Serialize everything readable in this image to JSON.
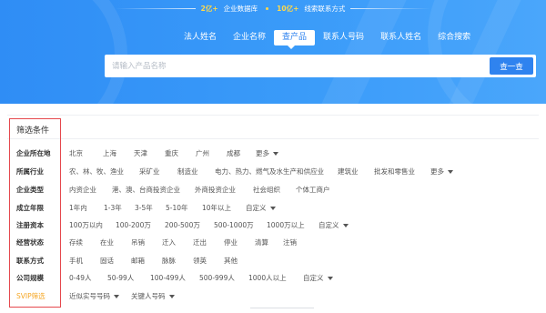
{
  "tagline": {
    "highlight_1": "2亿+",
    "text_1": "企业数据库",
    "highlight_2": "10亿+",
    "text_2": "线索联系方式"
  },
  "tabs": [
    {
      "label": "法人姓名",
      "active": false
    },
    {
      "label": "企业名称",
      "active": false
    },
    {
      "label": "查产品",
      "active": true
    },
    {
      "label": "联系人号码",
      "active": false
    },
    {
      "label": "联系人姓名",
      "active": false
    },
    {
      "label": "综合搜索",
      "active": false
    }
  ],
  "search": {
    "placeholder": "请输入产品名称",
    "value": "",
    "button_label": "查一查"
  },
  "filter": {
    "title": "筛选条件",
    "rows": [
      {
        "label": "企业所在地",
        "options": [
          "北京",
          "上海",
          "天津",
          "重庆",
          "广州",
          "成都",
          "更多"
        ]
      },
      {
        "label": "所属行业",
        "options": [
          "农、林、牧、渔业",
          "采矿业",
          "制造业",
          "电力、热力、燃气及水生产和供应业",
          "建筑业",
          "批发和零售业",
          "更多"
        ]
      },
      {
        "label": "企业类型",
        "options": [
          "内资企业",
          "港、澳、台商投资企业",
          "外商投资企业",
          "社会组织",
          "个体工商户"
        ]
      },
      {
        "label": "成立年限",
        "options": [
          "1年内",
          "1-3年",
          "3-5年",
          "5-10年",
          "10年以上",
          "自定义"
        ]
      },
      {
        "label": "注册资本",
        "options": [
          "100万以内",
          "100-200万",
          "200-500万",
          "500-1000万",
          "1000万以上",
          "自定义"
        ]
      },
      {
        "label": "经营状态",
        "options": [
          "存续",
          "在业",
          "吊销",
          "迁入",
          "迁出",
          "停业",
          "清算",
          "注销"
        ]
      },
      {
        "label": "联系方式",
        "options": [
          "手机",
          "固话",
          "邮箱",
          "脉脉",
          "领英",
          "其他"
        ]
      },
      {
        "label": "公司规模",
        "options": [
          "0-49人",
          "50-99人",
          "100-499人",
          "500-999人",
          "1000人以上",
          "自定义"
        ]
      },
      {
        "label": "SVIP筛选",
        "options": [
          "近似实号号码",
          "关键人号码"
        ]
      }
    ]
  },
  "colors": {
    "brand_blue": "#2f83ef",
    "accent_yellow": "#ffd84a",
    "svip_orange": "#f5a623",
    "highlight_red": "#e5484d"
  }
}
